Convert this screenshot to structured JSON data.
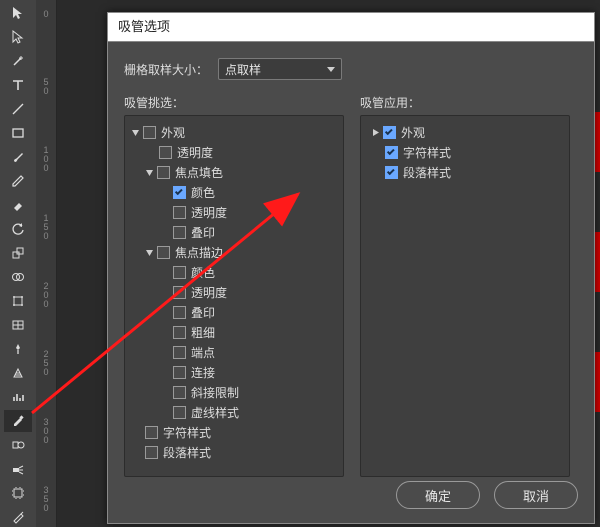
{
  "ruler": {
    "ticks": [
      "0",
      "50",
      "100",
      "150",
      "200",
      "250",
      "300",
      "350"
    ]
  },
  "toolbar": {
    "activeIndex": 17
  },
  "dialog": {
    "title": "吸管选项",
    "sampleLabel": "栅格取样大小：",
    "sampleValue": "点取样",
    "leftHead": "吸管挑选：",
    "rightHead": "吸管应用：",
    "ok": "确定",
    "cancel": "取消"
  },
  "leftTree": [
    {
      "d": 0,
      "tw": "open",
      "chk": false,
      "label": "外观"
    },
    {
      "d": 1,
      "tw": "",
      "chk": false,
      "label": "透明度"
    },
    {
      "d": 1,
      "tw": "open",
      "chk": false,
      "label": "焦点填色"
    },
    {
      "d": 2,
      "tw": "",
      "chk": true,
      "label": "颜色"
    },
    {
      "d": 2,
      "tw": "",
      "chk": false,
      "label": "透明度"
    },
    {
      "d": 2,
      "tw": "",
      "chk": false,
      "label": "叠印"
    },
    {
      "d": 1,
      "tw": "open",
      "chk": false,
      "label": "焦点描边"
    },
    {
      "d": 2,
      "tw": "",
      "chk": false,
      "label": "颜色"
    },
    {
      "d": 2,
      "tw": "",
      "chk": false,
      "label": "透明度"
    },
    {
      "d": 2,
      "tw": "",
      "chk": false,
      "label": "叠印"
    },
    {
      "d": 2,
      "tw": "",
      "chk": false,
      "label": "粗细"
    },
    {
      "d": 2,
      "tw": "",
      "chk": false,
      "label": "端点"
    },
    {
      "d": 2,
      "tw": "",
      "chk": false,
      "label": "连接"
    },
    {
      "d": 2,
      "tw": "",
      "chk": false,
      "label": "斜接限制"
    },
    {
      "d": 2,
      "tw": "",
      "chk": false,
      "label": "虚线样式"
    },
    {
      "d": 0,
      "tw": "",
      "chk": false,
      "label": "字符样式"
    },
    {
      "d": 0,
      "tw": "",
      "chk": false,
      "label": "段落样式"
    }
  ],
  "rightTree": [
    {
      "d": 0,
      "tw": "closed",
      "chk": true,
      "label": "外观"
    },
    {
      "d": 0,
      "tw": "",
      "chk": true,
      "label": "字符样式"
    },
    {
      "d": 0,
      "tw": "",
      "chk": true,
      "label": "段落样式"
    }
  ],
  "annotation": {
    "arrowColor": "#ff1a1a"
  }
}
